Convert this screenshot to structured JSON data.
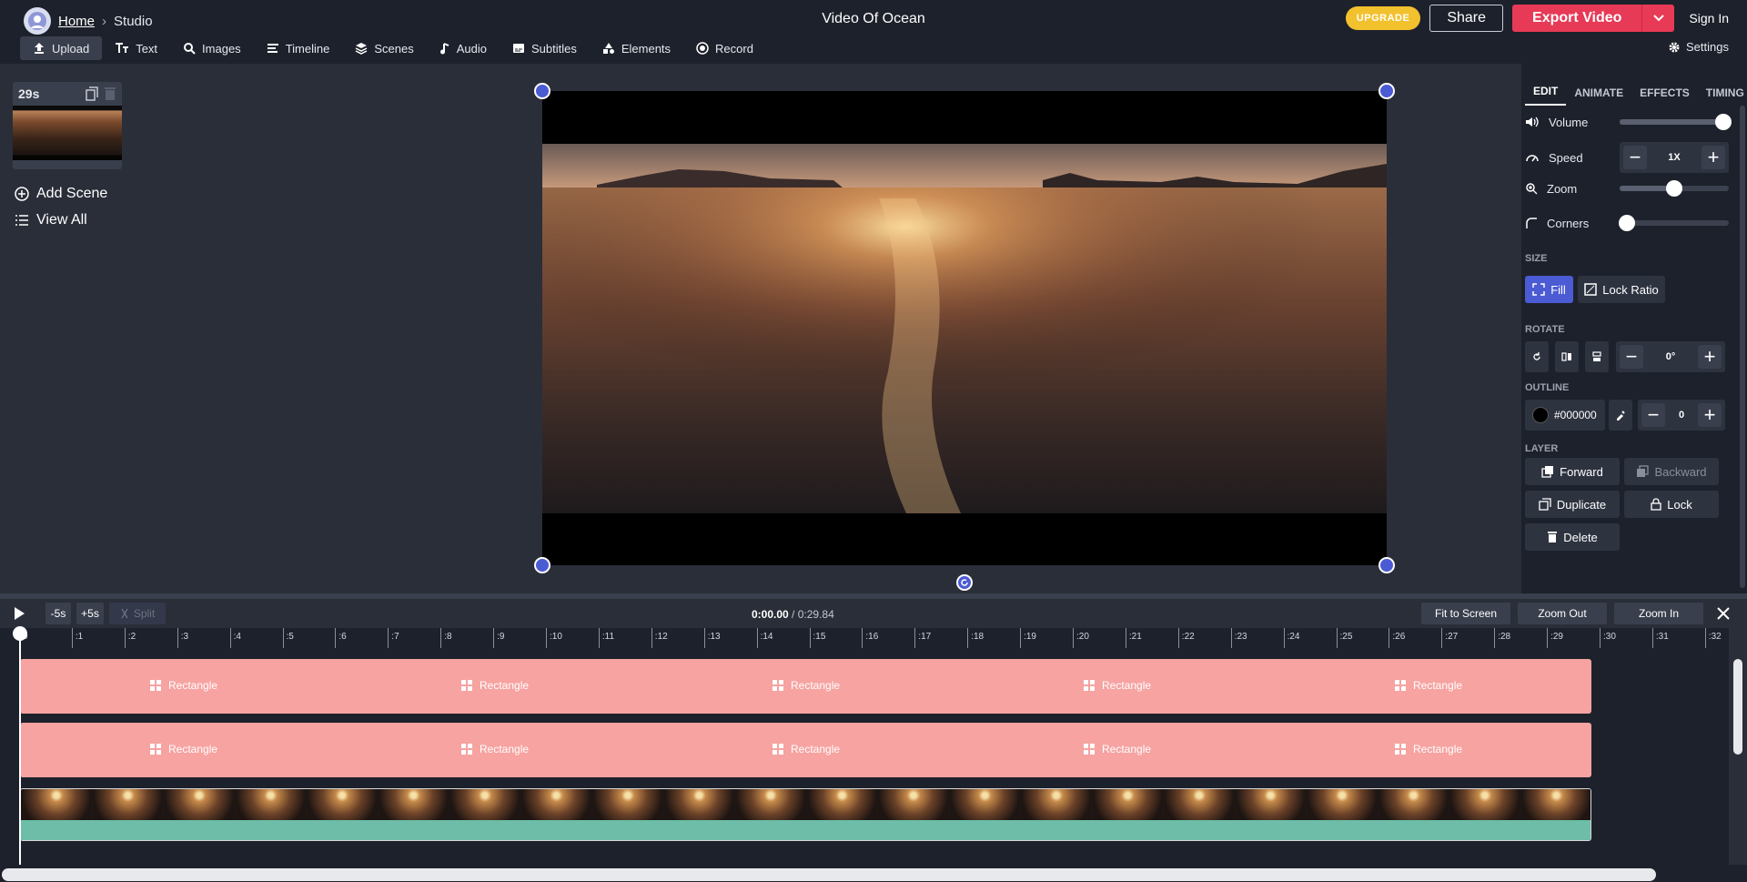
{
  "breadcrumb": {
    "home": "Home",
    "separator": "›",
    "current": "Studio"
  },
  "project_title": "Video Of Ocean",
  "header": {
    "upgrade_label": "UPGRADE",
    "share_label": "Share",
    "export_label": "Export Video",
    "signin_label": "Sign In"
  },
  "toolbar": {
    "items": [
      {
        "label": "Upload",
        "icon": "upload-icon",
        "active": true
      },
      {
        "label": "Text",
        "icon": "text-icon"
      },
      {
        "label": "Images",
        "icon": "search-icon"
      },
      {
        "label": "Timeline",
        "icon": "timeline-icon"
      },
      {
        "label": "Scenes",
        "icon": "layers-icon"
      },
      {
        "label": "Audio",
        "icon": "music-note-icon"
      },
      {
        "label": "Subtitles",
        "icon": "subtitles-icon"
      },
      {
        "label": "Elements",
        "icon": "shapes-icon"
      },
      {
        "label": "Record",
        "icon": "record-icon"
      }
    ],
    "settings_label": "Settings"
  },
  "scenes": {
    "scene_duration": "29s",
    "add_scene_label": "Add Scene",
    "view_all_label": "View All"
  },
  "panel": {
    "tabs": [
      "EDIT",
      "ANIMATE",
      "EFFECTS",
      "TIMING"
    ],
    "active_tab": "EDIT",
    "volume": {
      "label": "Volume",
      "value": 0.95
    },
    "speed": {
      "label": "Speed",
      "value": "1X"
    },
    "zoom": {
      "label": "Zoom",
      "value": 0.5
    },
    "corners": {
      "label": "Corners",
      "value": 0.0
    },
    "size": {
      "section": "SIZE",
      "fill_label": "Fill",
      "lock_ratio_label": "Lock Ratio"
    },
    "rotate": {
      "section": "ROTATE",
      "value": "0°"
    },
    "outline": {
      "section": "OUTLINE",
      "color": "#000000",
      "width": "0"
    },
    "layer": {
      "section": "LAYER",
      "forward_label": "Forward",
      "backward_label": "Backward",
      "duplicate_label": "Duplicate",
      "lock_label": "Lock",
      "delete_label": "Delete"
    }
  },
  "timeline": {
    "back_label": "-5s",
    "forward_label": "+5s",
    "split_label": "Split",
    "current_time": "0:00.00",
    "separator": "/",
    "total_time": "0:29.84",
    "fit_label": "Fit to Screen",
    "zoom_out_label": "Zoom Out",
    "zoom_in_label": "Zoom In",
    "ticks": [
      "0",
      ":1",
      ":2",
      ":3",
      ":4",
      ":5",
      ":6",
      ":7",
      ":8",
      ":9",
      ":10",
      ":11",
      ":12",
      ":13",
      ":14",
      ":15",
      ":16",
      ":17",
      ":18",
      ":19",
      ":20",
      ":21",
      ":22",
      ":23",
      ":24",
      ":25",
      ":26",
      ":27",
      ":28",
      ":29",
      ":30",
      ":31",
      ":32"
    ],
    "element_label": "Rectangle"
  },
  "colors": {
    "accent": "#4b5bd4",
    "export": "#e73a56",
    "upgrade": "#f2c12e",
    "rect_track": "#f6a3a1",
    "audio_track": "#6dbda8"
  }
}
